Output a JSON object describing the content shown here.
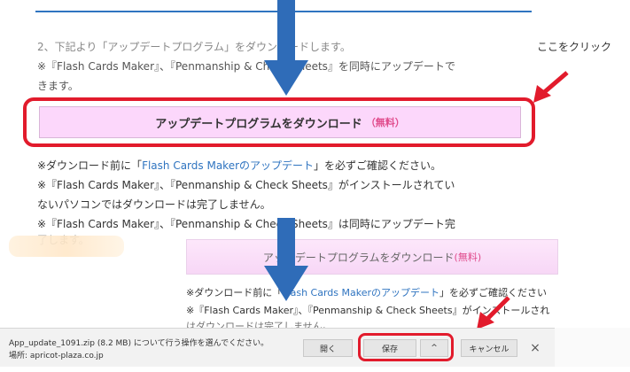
{
  "instructions": {
    "step": "2、下記より「アップデートプログラム」をダウンロードします。",
    "note1": "※『Flash Cards Maker』、『Penmanship & Check Sheets』を同時にアップデートで",
    "note1b": "きます。"
  },
  "callout": {
    "text": "ここをクリック"
  },
  "download_button": {
    "label": "アップデートプログラムをダウンロード",
    "free": "（無料）"
  },
  "notes": {
    "n1_prefix": "※ダウンロード前に「",
    "n1_link": "Flash Cards Makerのアップデート",
    "n1_suffix": "」を必ずご確認ください。",
    "n2": "※『Flash Cards Maker』、『Penmanship & Check Sheets』がインストールされてい",
    "n3": "ないパソコンではダウンロードは完了しません。",
    "n4": "※『Flash Cards Maker』、『Penmanship & Check Sheets』は同時にアップデート完",
    "n5": "了します。"
  },
  "zoomed": {
    "button_label": "アップデートプログラムをダウンロード",
    "button_free": "(無料)",
    "line1_prefix": "※ダウンロード前に「",
    "line1_link": "Flash Cards Makerのアップデート",
    "line1_suffix": "」を必ずご確認ください",
    "line2": "※『Flash Cards Maker』、『Penmanship & Check Sheets』がインストールされ",
    "line3": "はダウンロードは完了しません。"
  },
  "download_bar": {
    "message": "App_update_1091.zip (8.2 MB) について行う操作を選んでください。",
    "source": "場所: apricot-plaza.co.jp",
    "open": "開く",
    "save": "保存",
    "save_menu": "^",
    "cancel": "キャンセル",
    "close": "×"
  },
  "colors": {
    "accent_blue": "#2f74c0",
    "highlight_red": "#e21b2c",
    "button_pink": "#fcd7fb"
  }
}
